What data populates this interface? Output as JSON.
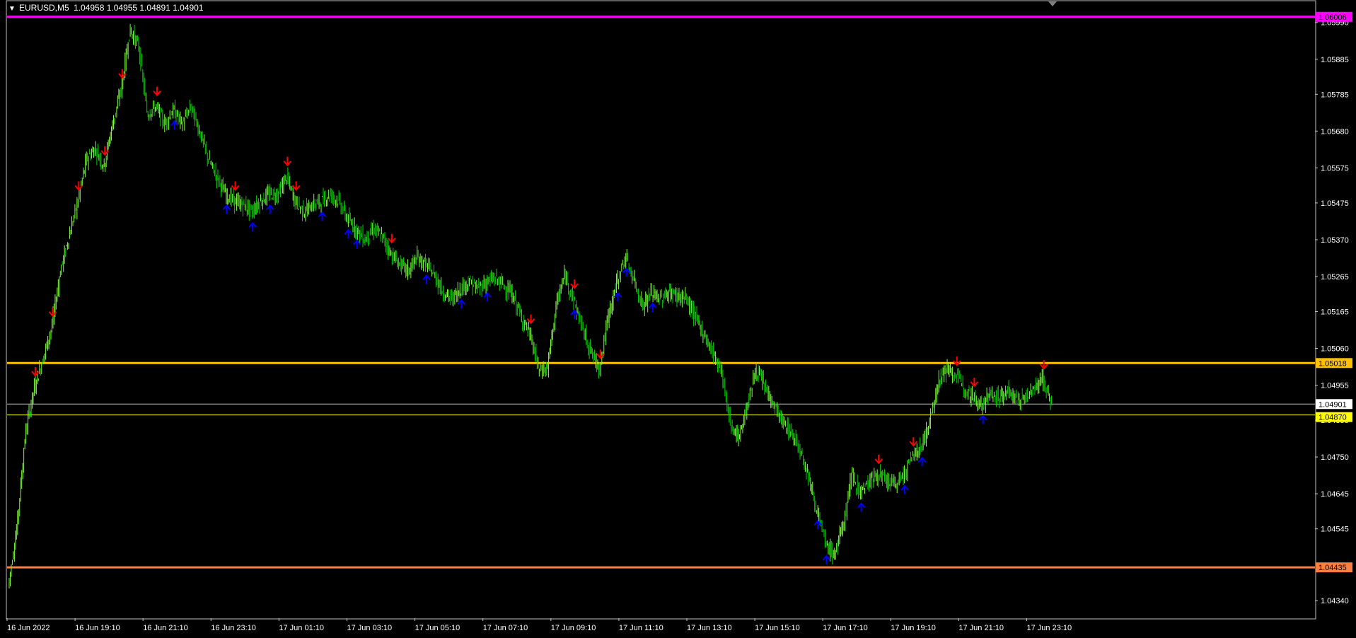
{
  "header": {
    "symbol_label": "EURUSD,M5",
    "ohlc_label": "1.04958 1.04955 1.04891 1.04901",
    "collapse_glyph": "▼"
  },
  "colors": {
    "background": "#000000",
    "frame": "#c0c0c0",
    "axis_text": "#ffffff",
    "candle": "#00d000",
    "candle_bright": "#7cff3a",
    "arrow_down": "#ff0000",
    "arrow_up": "#0000ff",
    "line_magenta": "#ff00ff",
    "line_gold": "#ffc000",
    "line_yellow": "#ffff00",
    "line_orange": "#ff7f3f",
    "bid_line": "#c0c0c0"
  },
  "chart_data": {
    "type": "candlestick",
    "symbol": "EURUSD",
    "timeframe": "M5",
    "ylim": [
      1.0429,
      1.0605
    ],
    "y_ticks": [
      1.0599,
      1.05885,
      1.05785,
      1.0568,
      1.05575,
      1.05475,
      1.0537,
      1.05265,
      1.05165,
      1.0506,
      1.04955,
      1.04855,
      1.0475,
      1.04645,
      1.04545,
      1.0434
    ],
    "x_ticks": [
      "16 Jun 2022",
      "16 Jun 19:10",
      "16 Jun 21:10",
      "16 Jun 23:10",
      "17 Jun 01:10",
      "17 Jun 03:10",
      "17 Jun 05:10",
      "17 Jun 07:10",
      "17 Jun 09:10",
      "17 Jun 11:10",
      "17 Jun 13:10",
      "17 Jun 15:10",
      "17 Jun 17:10",
      "17 Jun 19:10",
      "17 Jun 21:10",
      "17 Jun 23:10"
    ],
    "price_path": [
      [
        0,
        1.0438
      ],
      [
        1,
        1.0455
      ],
      [
        2,
        1.0482
      ],
      [
        3,
        1.0495
      ],
      [
        4,
        1.0503
      ],
      [
        5,
        1.0512
      ],
      [
        6,
        1.0528
      ],
      [
        7,
        1.0538
      ],
      [
        8,
        1.0548
      ],
      [
        9,
        1.056
      ],
      [
        10,
        1.0563
      ],
      [
        11,
        1.0558
      ],
      [
        12,
        1.057
      ],
      [
        13,
        1.058
      ],
      [
        14,
        1.0597
      ],
      [
        15,
        1.0592
      ],
      [
        16,
        1.0573
      ],
      [
        17,
        1.0575
      ],
      [
        18,
        1.057
      ],
      [
        19,
        1.0574
      ],
      [
        20,
        1.057
      ],
      [
        21,
        1.0575
      ],
      [
        22,
        1.0568
      ],
      [
        23,
        1.056
      ],
      [
        24,
        1.0555
      ],
      [
        25,
        1.055
      ],
      [
        26,
        1.0548
      ],
      [
        27,
        1.0547
      ],
      [
        28,
        1.0545
      ],
      [
        29,
        1.0548
      ],
      [
        30,
        1.055
      ],
      [
        31,
        1.055
      ],
      [
        32,
        1.0555
      ],
      [
        33,
        1.0548
      ],
      [
        34,
        1.0545
      ],
      [
        35,
        1.0547
      ],
      [
        36,
        1.0548
      ],
      [
        37,
        1.055
      ],
      [
        38,
        1.0548
      ],
      [
        39,
        1.0543
      ],
      [
        40,
        1.054
      ],
      [
        41,
        1.0537
      ],
      [
        42,
        1.054
      ],
      [
        43,
        1.0538
      ],
      [
        44,
        1.0533
      ],
      [
        45,
        1.053
      ],
      [
        46,
        1.0528
      ],
      [
        47,
        1.0532
      ],
      [
        48,
        1.053
      ],
      [
        49,
        1.0527
      ],
      [
        50,
        1.0522
      ],
      [
        51,
        1.052
      ],
      [
        52,
        1.0523
      ],
      [
        53,
        1.0525
      ],
      [
        54,
        1.0523
      ],
      [
        55,
        1.0525
      ],
      [
        56,
        1.0526
      ],
      [
        57,
        1.0524
      ],
      [
        58,
        1.0521
      ],
      [
        59,
        1.0515
      ],
      [
        60,
        1.051
      ],
      [
        61,
        1.05
      ],
      [
        62,
        1.05
      ],
      [
        63,
        1.0518
      ],
      [
        64,
        1.0527
      ],
      [
        65,
        1.052
      ],
      [
        66,
        1.0512
      ],
      [
        67,
        1.0505
      ],
      [
        68,
        1.05
      ],
      [
        69,
        1.0515
      ],
      [
        70,
        1.0525
      ],
      [
        71,
        1.0532
      ],
      [
        72,
        1.0525
      ],
      [
        73,
        1.0518
      ],
      [
        74,
        1.0522
      ],
      [
        75,
        1.052
      ],
      [
        76,
        1.0522
      ],
      [
        77,
        1.0521
      ],
      [
        78,
        1.052
      ],
      [
        79,
        1.0515
      ],
      [
        80,
        1.051
      ],
      [
        81,
        1.0505
      ],
      [
        82,
        1.05
      ],
      [
        83,
        1.0485
      ],
      [
        84,
        1.048
      ],
      [
        85,
        1.049
      ],
      [
        86,
        1.05
      ],
      [
        87,
        1.0495
      ],
      [
        88,
        1.049
      ],
      [
        89,
        1.0485
      ],
      [
        90,
        1.0482
      ],
      [
        91,
        1.0478
      ],
      [
        92,
        1.047
      ],
      [
        93,
        1.046
      ],
      [
        94,
        1.045
      ],
      [
        95,
        1.0447
      ],
      [
        96,
        1.0455
      ],
      [
        97,
        1.047
      ],
      [
        98,
        1.0465
      ],
      [
        99,
        1.0468
      ],
      [
        100,
        1.047
      ],
      [
        101,
        1.0468
      ],
      [
        102,
        1.0467
      ],
      [
        103,
        1.047
      ],
      [
        104,
        1.0475
      ],
      [
        105,
        1.0478
      ],
      [
        106,
        1.0485
      ],
      [
        107,
        1.0497
      ],
      [
        108,
        1.05
      ],
      [
        109,
        1.0498
      ],
      [
        110,
        1.0495
      ],
      [
        111,
        1.0492
      ],
      [
        112,
        1.049
      ],
      [
        113,
        1.0493
      ],
      [
        114,
        1.0492
      ],
      [
        115,
        1.0494
      ],
      [
        116,
        1.0491
      ],
      [
        117,
        1.0492
      ],
      [
        118,
        1.0495
      ],
      [
        119,
        1.0497
      ],
      [
        120,
        1.049
      ]
    ],
    "down_arrows": [
      3,
      5,
      8,
      11,
      13,
      17,
      26,
      32,
      33,
      44,
      60,
      65,
      68,
      100,
      104,
      109,
      111,
      119
    ],
    "up_arrows": [
      19,
      25,
      28,
      30,
      36,
      39,
      40,
      48,
      52,
      55,
      65,
      70,
      71,
      74,
      93,
      94,
      98,
      103,
      105,
      112
    ],
    "horizontal_lines": [
      {
        "price": 1.06006,
        "label": "1.06006",
        "color": "#ff00ff"
      },
      {
        "price": 1.05018,
        "label": "1.05018",
        "color": "#ffc000"
      },
      {
        "price": 1.04901,
        "label": "1.04901",
        "color": "#c0c0c0"
      },
      {
        "price": 1.0487,
        "label": "1.04870",
        "color": "#ffff00"
      },
      {
        "price": 1.04435,
        "label": "1.04435",
        "color": "#ff7f3f"
      }
    ],
    "grid": false
  }
}
